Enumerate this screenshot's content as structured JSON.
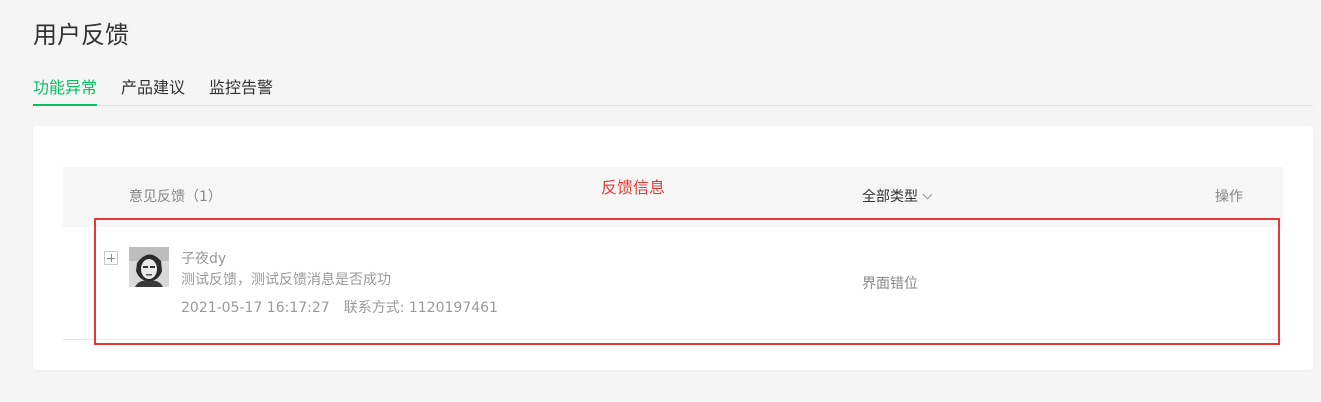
{
  "page": {
    "title": "用户反馈"
  },
  "tabs": [
    {
      "label": "功能异常",
      "active": true
    },
    {
      "label": "产品建议",
      "active": false
    },
    {
      "label": "监控告警",
      "active": false
    }
  ],
  "annotation": {
    "label": "反馈信息",
    "color": "#e53935"
  },
  "table": {
    "headers": {
      "feedback": "意见反馈（1）",
      "type": "全部类型",
      "action": "操作"
    },
    "rows": [
      {
        "user_name": "子夜dy",
        "message": "测试反馈，测试反馈消息是否成功",
        "datetime": "2021-05-17 16:17:27",
        "contact": "联系方式: 1120197461",
        "type": "界面错位"
      }
    ]
  },
  "colors": {
    "accent": "#07c160",
    "annotation": "#e53935"
  }
}
